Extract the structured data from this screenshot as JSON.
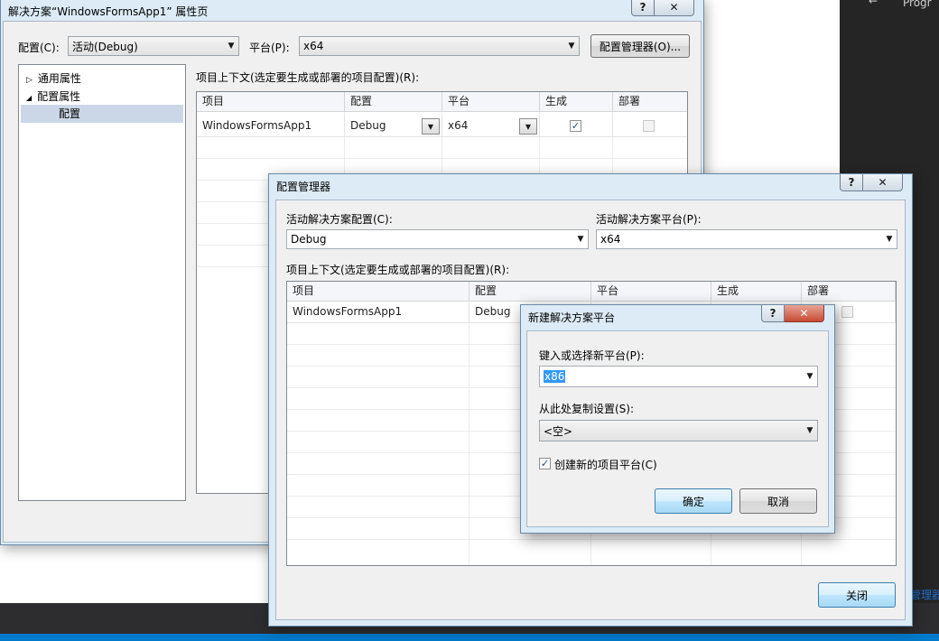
{
  "ide": {
    "dark_panel_text": "Progr",
    "dark_panel_arrow": "←",
    "link_text": "管理器"
  },
  "props_window": {
    "title": "解决方案“WindowsFormsApp1” 属性页",
    "help_label": "?",
    "close_label": "✕",
    "config_label": "配置(C):",
    "config_value": "活动(Debug)",
    "platform_label": "平台(P):",
    "platform_value": "x64",
    "config_manager_button": "配置管理器(O)...",
    "tree": [
      {
        "expander": "▷",
        "label": "通用属性"
      },
      {
        "expander": "◢",
        "label": "配置属性"
      },
      {
        "expander": "",
        "label": "配置"
      }
    ],
    "context_label": "项目上下文(选定要生成或部署的项目配置)(R):",
    "grid_headers": [
      "项目",
      "配置",
      "平台",
      "生成",
      "部署"
    ],
    "row": {
      "project": "WindowsFormsApp1",
      "config": "Debug",
      "platform": "x64",
      "build": "✓"
    }
  },
  "config_manager": {
    "title": "配置管理器",
    "help_label": "?",
    "close_label": "✕",
    "solution_config_label": "活动解决方案配置(C):",
    "solution_config_value": "Debug",
    "solution_platform_label": "活动解决方案平台(P):",
    "solution_platform_value": "x64",
    "context_label": "项目上下文(选定要生成或部署的项目配置)(R):",
    "grid_headers": [
      "项目",
      "配置",
      "平台",
      "生成",
      "部署"
    ],
    "row": {
      "project": "WindowsFormsApp1",
      "config": "Debug"
    },
    "close_button": "关闭"
  },
  "new_platform": {
    "title": "新建解决方案平台",
    "help_label": "?",
    "close_label": "✕",
    "platform_label": "键入或选择新平台(P):",
    "platform_value": "x86",
    "copy_label": "从此处复制设置(S):",
    "copy_value": "<空>",
    "create_checkbox_label": "创建新的项目平台(C)",
    "create_checked": "✓",
    "ok_button": "确定",
    "cancel_button": "取消"
  },
  "icons": {
    "dropdown": "▼",
    "checkmark": "✓"
  },
  "colors": {
    "title_bar": "#dcebf6",
    "selection": "#3399ff",
    "ide_dark": "#252526",
    "ide_status": "#007acc",
    "link": "#1e6fd0"
  }
}
